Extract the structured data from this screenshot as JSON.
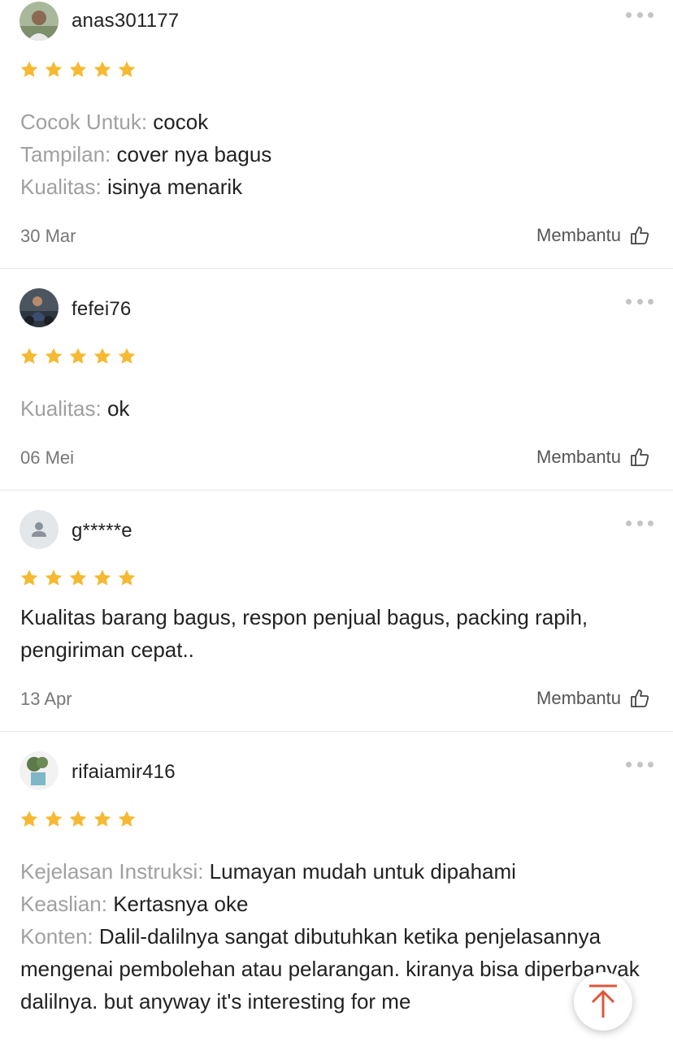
{
  "reviews": [
    {
      "username": "anas301177",
      "rating": 5,
      "attributes": [
        {
          "label": "Cocok Untuk:",
          "value": " cocok"
        },
        {
          "label": "Tampilan:",
          "value": " cover nya bagus"
        },
        {
          "label": "Kualitas:",
          "value": " isinya menarik"
        }
      ],
      "date": "30 Mar",
      "helpful_label": "Membantu"
    },
    {
      "username": "fefei76",
      "rating": 5,
      "attributes": [
        {
          "label": "Kualitas:",
          "value": " ok"
        }
      ],
      "date": "06 Mei",
      "helpful_label": "Membantu"
    },
    {
      "username": "g*****e",
      "rating": 5,
      "text": "Kualitas barang bagus, respon penjual bagus, packing rapih, pengiriman cepat..",
      "date": "13 Apr",
      "helpful_label": "Membantu"
    },
    {
      "username": "rifaiamir416",
      "rating": 5,
      "attributes": [
        {
          "label": "Kejelasan Instruksi:",
          "value": " Lumayan mudah untuk dipahami"
        },
        {
          "label": "Keaslian:",
          "value": " Kertasnya oke"
        }
      ],
      "content_label": "Konten:",
      "content_value": " Dalil-dalilnya sangat dibutuhkan ketika penjelasannya mengenai pembolehan atau pelarangan. kiranya bisa diperbanyak dalilnya. but anyway it's interesting for me"
    }
  ],
  "colors": {
    "star": "#f5b932",
    "accent": "#e0563b",
    "muted_label": "#a0a0a0"
  },
  "icons": {
    "more": "more-horizontal-icon",
    "helpful": "thumbs-up-icon",
    "scroll_top": "arrow-up-icon",
    "star": "star-icon"
  }
}
